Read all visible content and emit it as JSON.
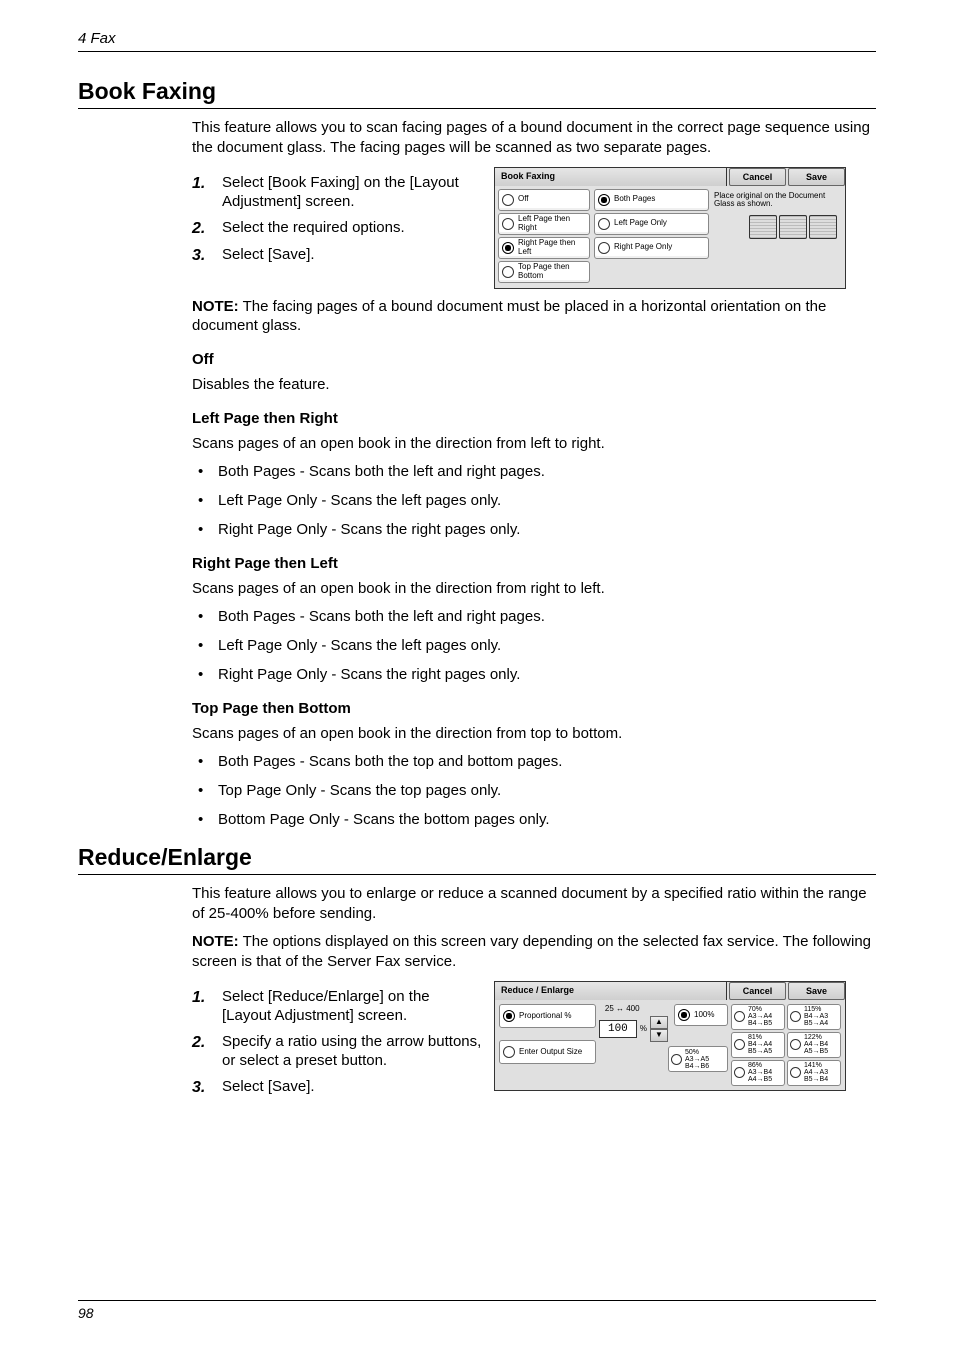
{
  "header": {
    "running": "4 Fax"
  },
  "footer": {
    "page": "98"
  },
  "section1": {
    "title": "Book Faxing",
    "intro": "This feature allows you to scan facing pages of a bound document in the correct page sequence using the document glass. The facing pages will be scanned as two separate pages.",
    "steps": {
      "n1": "1.",
      "s1": "Select [Book Faxing] on the [Layout Adjustment] screen.",
      "n2": "2.",
      "s2": "Select the required options.",
      "n3": "3.",
      "s3": "Select [Save]."
    },
    "note_label": "NOTE:",
    "note": " The facing pages of a bound document must be placed in a horizontal orientation on the document glass.",
    "off": {
      "h": "Off",
      "p": "Disables the feature."
    },
    "lpr": {
      "h": "Left Page then Right",
      "p": "Scans pages of an open book in the direction from left to right.",
      "b1": "Both Pages - Scans both the left and right pages.",
      "b2": "Left Page Only - Scans the left pages only.",
      "b3": "Right Page Only - Scans the right pages only."
    },
    "rpl": {
      "h": "Right Page then Left",
      "p": "Scans pages of an open book in the direction from right to left.",
      "b1": "Both Pages - Scans both the left and right pages.",
      "b2": "Left Page Only - Scans the left pages only.",
      "b3": "Right Page Only - Scans the right pages only."
    },
    "tpb": {
      "h": "Top Page then Bottom",
      "p": "Scans pages of an open book in the direction from top to bottom.",
      "b1": "Both Pages - Scans both the top and bottom pages.",
      "b2": "Top Page Only - Scans the top pages only.",
      "b3": "Bottom Page Only - Scans the bottom pages only."
    },
    "fig": {
      "title": "Book Faxing",
      "cancel": "Cancel",
      "save": "Save",
      "opt_off": "Off",
      "opt_lpr": "Left Page then Right",
      "opt_rpl": "Right Page then Left",
      "opt_tpb": "Top Page then Bottom",
      "opt_both": "Both Pages",
      "opt_lpo": "Left Page Only",
      "opt_rpo": "Right Page Only",
      "instr": "Place original on the Document Glass as shown."
    }
  },
  "section2": {
    "title": "Reduce/Enlarge",
    "intro": "This feature allows you to enlarge or reduce a scanned document by a specified ratio within the range of 25-400% before sending.",
    "note_label": "NOTE:",
    "note": " The options displayed on this screen vary depending on the selected fax service. The following screen is that of the Server Fax service.",
    "steps": {
      "n1": "1.",
      "s1": "Select [Reduce/Enlarge] on the [Layout Adjustment] screen.",
      "n2": "2.",
      "s2": "Specify a ratio using the arrow buttons, or select a preset button.",
      "n3": "3.",
      "s3": "Select [Save]."
    },
    "fig": {
      "title": "Reduce / Enlarge",
      "cancel": "Cancel",
      "save": "Save",
      "prop": "Proportional %",
      "eos": "Enter Output Size",
      "range": "25 ↔ 400",
      "pct": "%",
      "val": "100",
      "p100": "100%",
      "p50": "50%\nA3→A5\nB4→B6",
      "p70": "70%\nA3→A4\nB4→B5",
      "p81": "81%\nB4→A4\nB5→A5",
      "p86": "86%\nA3→B4\nA4→B5",
      "p115": "115%\nB4→A3\nB5→A4",
      "p122": "122%\nA4→B4\nA5→B5",
      "p141": "141%\nA4→A3\nB5→B4"
    }
  }
}
